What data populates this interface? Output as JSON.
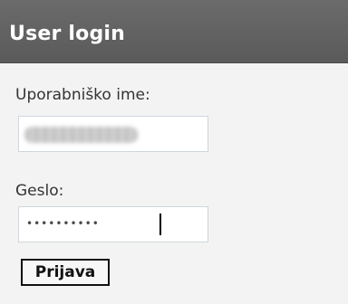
{
  "block": {
    "title": "User login"
  },
  "form": {
    "username_label": "Uporabniško ime:",
    "password_label": "Geslo:",
    "password_mask": "••••••••••",
    "submit_label": "Prijava"
  }
}
